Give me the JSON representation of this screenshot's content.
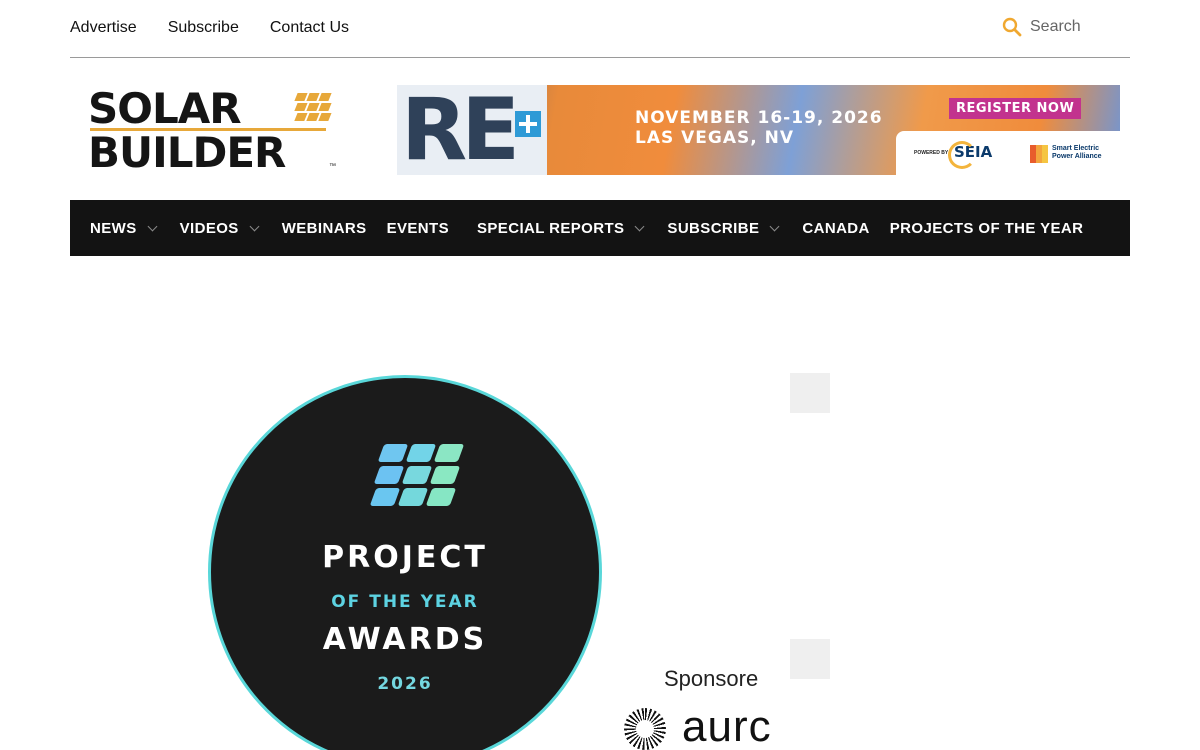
{
  "top_links": [
    "Advertise",
    "Subscribe",
    "Contact Us"
  ],
  "search": {
    "placeholder": "Search",
    "icon": "search-icon",
    "icon_color": "#f0a830"
  },
  "logo": {
    "line1": "SOLAR",
    "line2": "BUILDER",
    "tm": "™",
    "accent_color": "#e7a83a"
  },
  "banner": {
    "brand": "RE",
    "dates": "NOVEMBER 16-19, 2026",
    "location": "LAS VEGAS, NV",
    "cta": "REGISTER NOW",
    "powered_by": "POWERED BY",
    "seia": "SEIA",
    "sepa": "Smart Electric Power Alliance"
  },
  "nav": {
    "items": [
      {
        "label": "NEWS",
        "dropdown": true
      },
      {
        "label": "VIDEOS",
        "dropdown": true
      },
      {
        "label": "WEBINARS",
        "dropdown": false
      },
      {
        "label": "EVENTS",
        "dropdown": false
      },
      {
        "label": "SPECIAL REPORTS",
        "dropdown": true
      },
      {
        "label": "SUBSCRIBE",
        "dropdown": true
      },
      {
        "label": "CANADA",
        "dropdown": false
      },
      {
        "label": "PROJECTS OF THE YEAR",
        "dropdown": false
      }
    ]
  },
  "award": {
    "line1": "PROJECT",
    "line2": "OF THE YEAR",
    "line3": "AWARDS",
    "year": "2026",
    "ring_color": "#59d7d9"
  },
  "sponsor": {
    "label": "Sponsore",
    "brand": "aurc"
  }
}
